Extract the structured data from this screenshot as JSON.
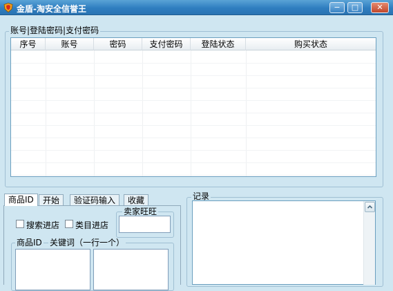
{
  "window": {
    "title": "金盾-淘安全信誉王",
    "minimize_glyph": "−",
    "maximize_glyph": "□",
    "close_glyph": "✕",
    "icon": "shield-icon"
  },
  "accounts_group": {
    "legend": "账号|登陆密码|支付密码",
    "columns": [
      "序号",
      "账号",
      "密码",
      "支付密码",
      "登陆状态",
      "购买状态"
    ]
  },
  "tabs": [
    {
      "label": "商品ID",
      "active": true
    },
    {
      "label": "开始",
      "active": false
    },
    {
      "label": "验证码输入",
      "active": false
    },
    {
      "label": "收藏",
      "active": false
    }
  ],
  "product_tab": {
    "search_store_label": "搜索进店",
    "search_store_checked": false,
    "category_store_label": "类目进店",
    "category_store_checked": false,
    "seller_group_legend": "卖家旺旺",
    "seller_value": "",
    "product_id_label": "商品ID",
    "keywords_label": "关键词（一行一个）",
    "product_id_text": "",
    "keywords_text": ""
  },
  "log_group": {
    "legend": "记录",
    "content": ""
  },
  "colors": {
    "titlebar": "#2f7ec0",
    "background": "#cfe6f1",
    "close_button": "#c0472c"
  }
}
